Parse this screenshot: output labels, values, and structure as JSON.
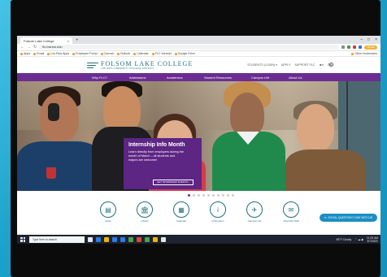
{
  "browser": {
    "tab_title": "Folsom Lake College",
    "new_tab_symbol": "+",
    "tab_close_symbol": "×",
    "url": "flc.losrios.edu",
    "profile_button": "Update",
    "window_controls": [
      "–",
      "□",
      "×"
    ],
    "nav_symbols": [
      "←",
      "→",
      "↻"
    ],
    "bookmarks": [
      "Apps",
      "Email",
      "Los Rios Apps",
      "Employee Portal",
      "Canvas",
      "Outlook",
      "Calendar",
      "FLC Intranet",
      "Google Drive"
    ],
    "other_bookmarks": "Other bookmarks"
  },
  "site": {
    "logo_name": "FOLSOM LAKE COLLEGE",
    "logo_tagline": "LOS RIOS COMMUNITY COLLEGE DISTRICT",
    "utility_links": [
      "STUDENTS (LOGIN) ▾",
      "APPLY",
      "SUPPORT FLC",
      "☻▾",
      "☰▾"
    ],
    "nav": [
      "Why FLC?",
      "Admissions",
      "Academics",
      "Student Resources",
      "Campus Life",
      "About Us"
    ],
    "hero": {
      "title": "Internship Info Month",
      "body": "Learn directly from employers during the month of March – all students and majors are welcome!",
      "button": "GET INTERNSHIP EVENTS  ›"
    },
    "carousel": {
      "count": 10,
      "active_index": 0
    },
    "quick_links": [
      {
        "label": "Apply",
        "icon": "▤"
      },
      {
        "label": "Library",
        "icon": "🏛"
      },
      {
        "label": "Calendar",
        "icon": "▦"
      },
      {
        "label": "Information",
        "icon": "i"
      },
      {
        "label": "Campus Life",
        "icon": "✈"
      },
      {
        "label": "Chat with Staff",
        "icon": "✉"
      }
    ],
    "chat_button": "SOCIAL QUESTION? CHAT WITH US",
    "chat_icon": "✉"
  },
  "taskbar": {
    "search_placeholder": "Type here to search",
    "weather": "55°F Cloudy",
    "time": "11:33 AM",
    "date": "3/7/2023"
  },
  "colors": {
    "brand_purple": "#6b2c91",
    "brand_teal": "#1e6f7c",
    "chat_blue": "#1b8fc3"
  }
}
